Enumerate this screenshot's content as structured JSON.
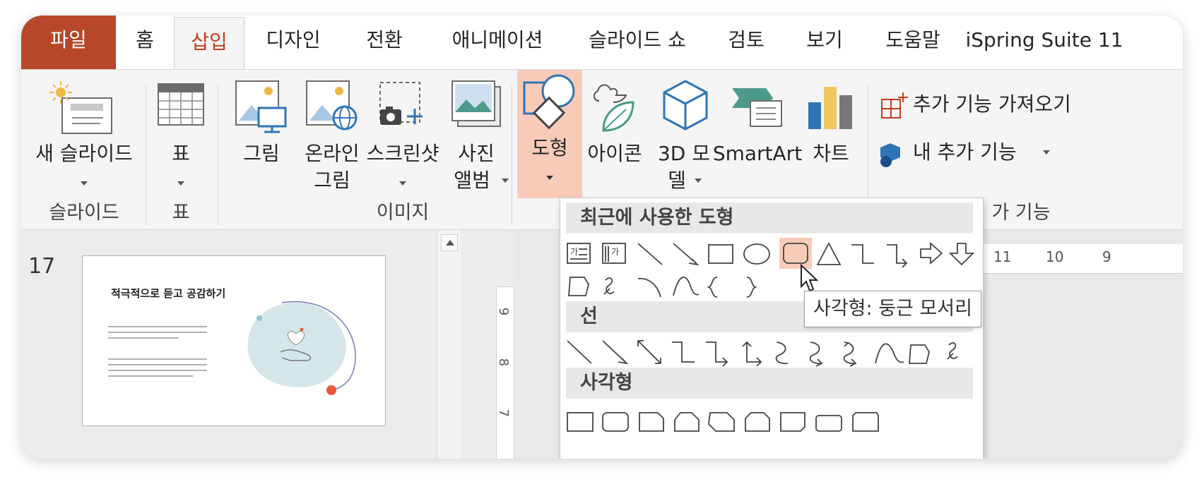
{
  "tabs": [
    {
      "label": "파일"
    },
    {
      "label": "홈"
    },
    {
      "label": "삽입"
    },
    {
      "label": "디자인"
    },
    {
      "label": "전환"
    },
    {
      "label": "애니메이션"
    },
    {
      "label": "슬라이드 쇼"
    },
    {
      "label": "검토"
    },
    {
      "label": "보기"
    },
    {
      "label": "도움말"
    },
    {
      "label": "iSpring Suite 11"
    }
  ],
  "ribbon": {
    "new_slide": "새 슬라이드",
    "table": "표",
    "picture": "그림",
    "online_picture_1": "온라인",
    "online_picture_2": "그림",
    "screenshot": "스크린샷",
    "album_1": "사진",
    "album_2": "앨범",
    "shapes": "도형",
    "icons": "아이콘",
    "model_1": "3D 모",
    "model_2": "델",
    "smartart": "SmartArt",
    "chart": "차트",
    "get_addins": "추가 기능 가져오기",
    "my_addins": "내 추가 기능",
    "groups": {
      "slides": "슬라이드",
      "table": "표",
      "images": "이미지",
      "addins": "가 기능"
    }
  },
  "gallery": {
    "recent": "최근에 사용한 도형",
    "lines": "선",
    "rectangles": "사각형",
    "tooltip": "사각형: 둥근 모서리"
  },
  "slide_panel": {
    "slide_number": "17",
    "slide_title": "적극적으로 듣고 공감하기"
  },
  "ruler": {
    "h_ticks": [
      "11",
      "10",
      "9"
    ],
    "v_ticks": [
      "9",
      "8",
      "7"
    ]
  },
  "colors": {
    "file_tab": "#b7472a",
    "active_tab_text": "#c43e1c",
    "shapes_highlight": "#f8cbb9",
    "accent_blue": "#2e75b6"
  }
}
